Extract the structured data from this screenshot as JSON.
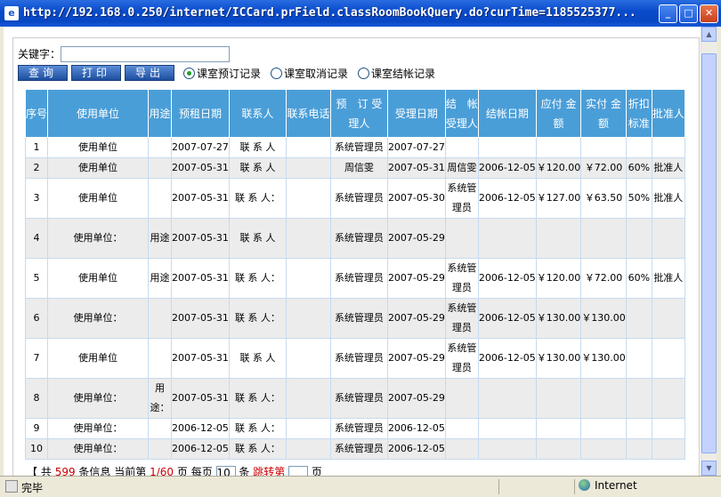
{
  "window": {
    "title": "http://192.168.0.250/internet/ICCard.prField.classRoomBookQuery.do?curTime=1185525377..."
  },
  "search": {
    "label": "关键字：",
    "value": ""
  },
  "buttons": {
    "query": "查询",
    "print": "打印",
    "export": "导出"
  },
  "radios": [
    {
      "label": "课室预订记录",
      "selected": true
    },
    {
      "label": "课室取消记录",
      "selected": false
    },
    {
      "label": "课室结帐记录",
      "selected": false
    }
  ],
  "table": {
    "headers": {
      "seq": "序号",
      "unit": "使用单位",
      "purpose": "用途",
      "prebook_date": "预租日期",
      "contact": "联系人",
      "phone": "联系电话",
      "receiver": "预　订 受理人",
      "accept_date": "受理日期",
      "settle_receiver": "结　帐 受理人",
      "settle_date": "结帐日期",
      "payable": "应付 金额",
      "paid": "实付 金额",
      "discount": "折扣 标准",
      "approver": "批准人"
    },
    "rows": [
      [
        "1",
        "使用单位",
        "",
        "2007-07-27",
        "联 系 人",
        "",
        "系统管理员",
        "2007-07-27",
        "",
        "",
        "",
        "",
        "",
        ""
      ],
      [
        "2",
        "使用单位",
        "",
        "2007-05-31",
        "联 系 人",
        "",
        "周信雯",
        "2007-05-31",
        "周信雯",
        "2006-12-05",
        "￥120.00",
        "￥72.00",
        "60%",
        "批准人"
      ],
      [
        "3",
        "使用单位",
        "",
        "2007-05-31",
        "联 系 人：",
        "",
        "系统管理员",
        "2007-05-30",
        "系统管理员",
        "2006-12-05",
        "￥127.00",
        "￥63.50",
        "50%",
        "批准人"
      ],
      [
        "4",
        "使用单位：",
        "用途",
        "2007-05-31",
        "联 系 人",
        "",
        "系统管理员",
        "2007-05-29",
        "",
        "",
        "",
        "",
        "",
        ""
      ],
      [
        "5",
        "使用单位",
        "用途",
        "2007-05-31",
        "联 系 人：",
        "",
        "系统管理员",
        "2007-05-29",
        "系统管理员",
        "2006-12-05",
        "￥120.00",
        "￥72.00",
        "60%",
        "批准人"
      ],
      [
        "6",
        "使用单位：",
        "",
        "2007-05-31",
        "联 系 人：",
        "",
        "系统管理员",
        "2007-05-29",
        "系统管理员",
        "2006-12-05",
        "￥130.00",
        "￥130.00",
        "",
        ""
      ],
      [
        "7",
        "使用单位",
        "",
        "2007-05-31",
        "联 系 人",
        "",
        "系统管理员",
        "2007-05-29",
        "系统管理员",
        "2006-12-05",
        "￥130.00",
        "￥130.00",
        "",
        ""
      ],
      [
        "8",
        "使用单位：",
        "用途：",
        "2007-05-31",
        "联 系 人：",
        "",
        "系统管理员",
        "2007-05-29",
        "",
        "",
        "",
        "",
        "",
        ""
      ],
      [
        "9",
        "使用单位：",
        "",
        "2006-12-05",
        "联 系 人：",
        "",
        "系统管理员",
        "2006-12-05",
        "",
        "",
        "",
        "",
        "",
        ""
      ],
      [
        "10",
        "使用单位：",
        "",
        "2006-12-05",
        "联 系 人：",
        "",
        "系统管理员",
        "2006-12-05",
        "",
        "",
        "",
        "",
        "",
        ""
      ]
    ]
  },
  "pager": {
    "prefix": "【",
    "total_label": "共",
    "total": "599",
    "items": "条信息",
    "current_label": "当前第",
    "current": "1/60",
    "page_label": "页 每页",
    "per_page": "10",
    "per_unit": "条",
    "jump": "跳转第",
    "page": "页"
  },
  "status": {
    "text": "完毕",
    "zone": "Internet"
  },
  "colors": {
    "header": "#4a9ed8",
    "titlebar": "#0a4ccd",
    "accent_red": "#cc0000"
  }
}
